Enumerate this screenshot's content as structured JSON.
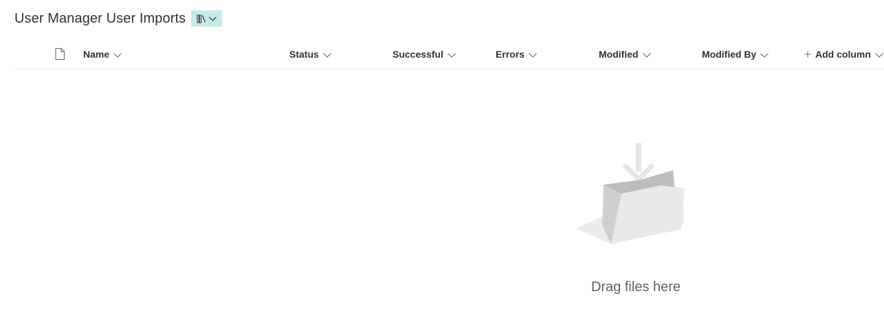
{
  "library": {
    "title": "User Manager User Imports",
    "view_icon": "library-icon"
  },
  "columns": {
    "file_type_icon": "document-icon",
    "name": "Name",
    "status": "Status",
    "successful": "Successful",
    "errors": "Errors",
    "modified": "Modified",
    "modified_by": "Modified By",
    "add_column": "Add column"
  },
  "empty_state": {
    "illustration_icon": "folder-drop-icon",
    "message": "Drag files here"
  },
  "colors": {
    "view_switch_bg": "#c4ebeb",
    "text_primary": "#323130",
    "text_secondary": "#605e5c",
    "divider": "#edebe9"
  }
}
